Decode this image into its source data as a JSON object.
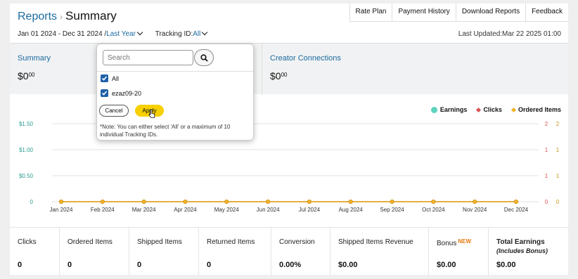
{
  "header": {
    "breadcrumb_link": "Reports",
    "breadcrumb_sep": "›",
    "title": "Summary",
    "tabs": [
      "Rate Plan",
      "Payment History",
      "Download Reports",
      "Feedback"
    ]
  },
  "filters": {
    "date_range": "Jan 01 2024 - Dec 31 2024 /",
    "period": "Last Year",
    "tracking_label": "Tracking ID:",
    "tracking_value": "All",
    "last_updated": "Last Updated:Mar 22 2025 01:00"
  },
  "summary_cards": [
    {
      "title": "Summary",
      "amount_main": "$0",
      "amount_cents": "00"
    },
    {
      "title": "Creator Connections",
      "amount_main": "$0",
      "amount_cents": "00"
    }
  ],
  "legend": [
    {
      "label": "Earnings",
      "color": "#5fd3c0"
    },
    {
      "label": "Clicks",
      "color": "#d9534f"
    },
    {
      "label": "Ordered Items",
      "color": "#f0b429"
    }
  ],
  "chart_data": {
    "type": "line",
    "categories": [
      "Jan 2024",
      "Feb 2024",
      "Mar 2024",
      "Apr 2024",
      "May 2024",
      "Jun 2024",
      "Jul 2024",
      "Aug 2024",
      "Sep 2024",
      "Oct 2024",
      "Nov 2024",
      "Dec 2024"
    ],
    "series": [
      {
        "name": "Earnings",
        "values": [
          0,
          0,
          0,
          0,
          0,
          0,
          0,
          0,
          0,
          0,
          0,
          0
        ],
        "color": "#5fd3c0"
      },
      {
        "name": "Clicks",
        "values": [
          0,
          0,
          0,
          0,
          0,
          0,
          0,
          0,
          0,
          0,
          0,
          0
        ],
        "color": "#d9534f"
      },
      {
        "name": "Ordered Items",
        "values": [
          0,
          0,
          0,
          0,
          0,
          0,
          0,
          0,
          0,
          0,
          0,
          0
        ],
        "color": "#f0b429"
      }
    ],
    "y_left_ticks": [
      "$1.50",
      "$1.00",
      "$0.50",
      "0"
    ],
    "y_right_clicks_ticks": [
      "2",
      "1",
      "1",
      "0"
    ],
    "y_right_items_ticks": [
      "2",
      "1",
      "1",
      "0"
    ],
    "ylim": [
      0,
      1.5
    ],
    "grid": true,
    "legend_position": "top-right"
  },
  "metrics": [
    {
      "label": "Clicks",
      "value": "0"
    },
    {
      "label": "Ordered Items",
      "value": "0"
    },
    {
      "label": "Shipped Items",
      "value": "0"
    },
    {
      "label": "Returned Items",
      "value": "0"
    },
    {
      "label": "Conversion",
      "value": "0.00%"
    },
    {
      "label": "Shipped Items Revenue",
      "value": "$0.00"
    },
    {
      "label": "Bonus",
      "badge": "NEW",
      "value": "$0.00"
    },
    {
      "label": "Total Earnings",
      "sublabel": "(Includes Bonus)",
      "value": "$0.00"
    }
  ],
  "tracking_popup": {
    "search_placeholder": "Search",
    "options": [
      {
        "label": "All",
        "checked": true
      },
      {
        "label": "ezaz09-20",
        "checked": true
      }
    ],
    "cancel_label": "Cancel",
    "apply_label": "Apply",
    "note": "*Note: You can either select 'All' or a maximum of 10 individual Tracking IDs."
  }
}
